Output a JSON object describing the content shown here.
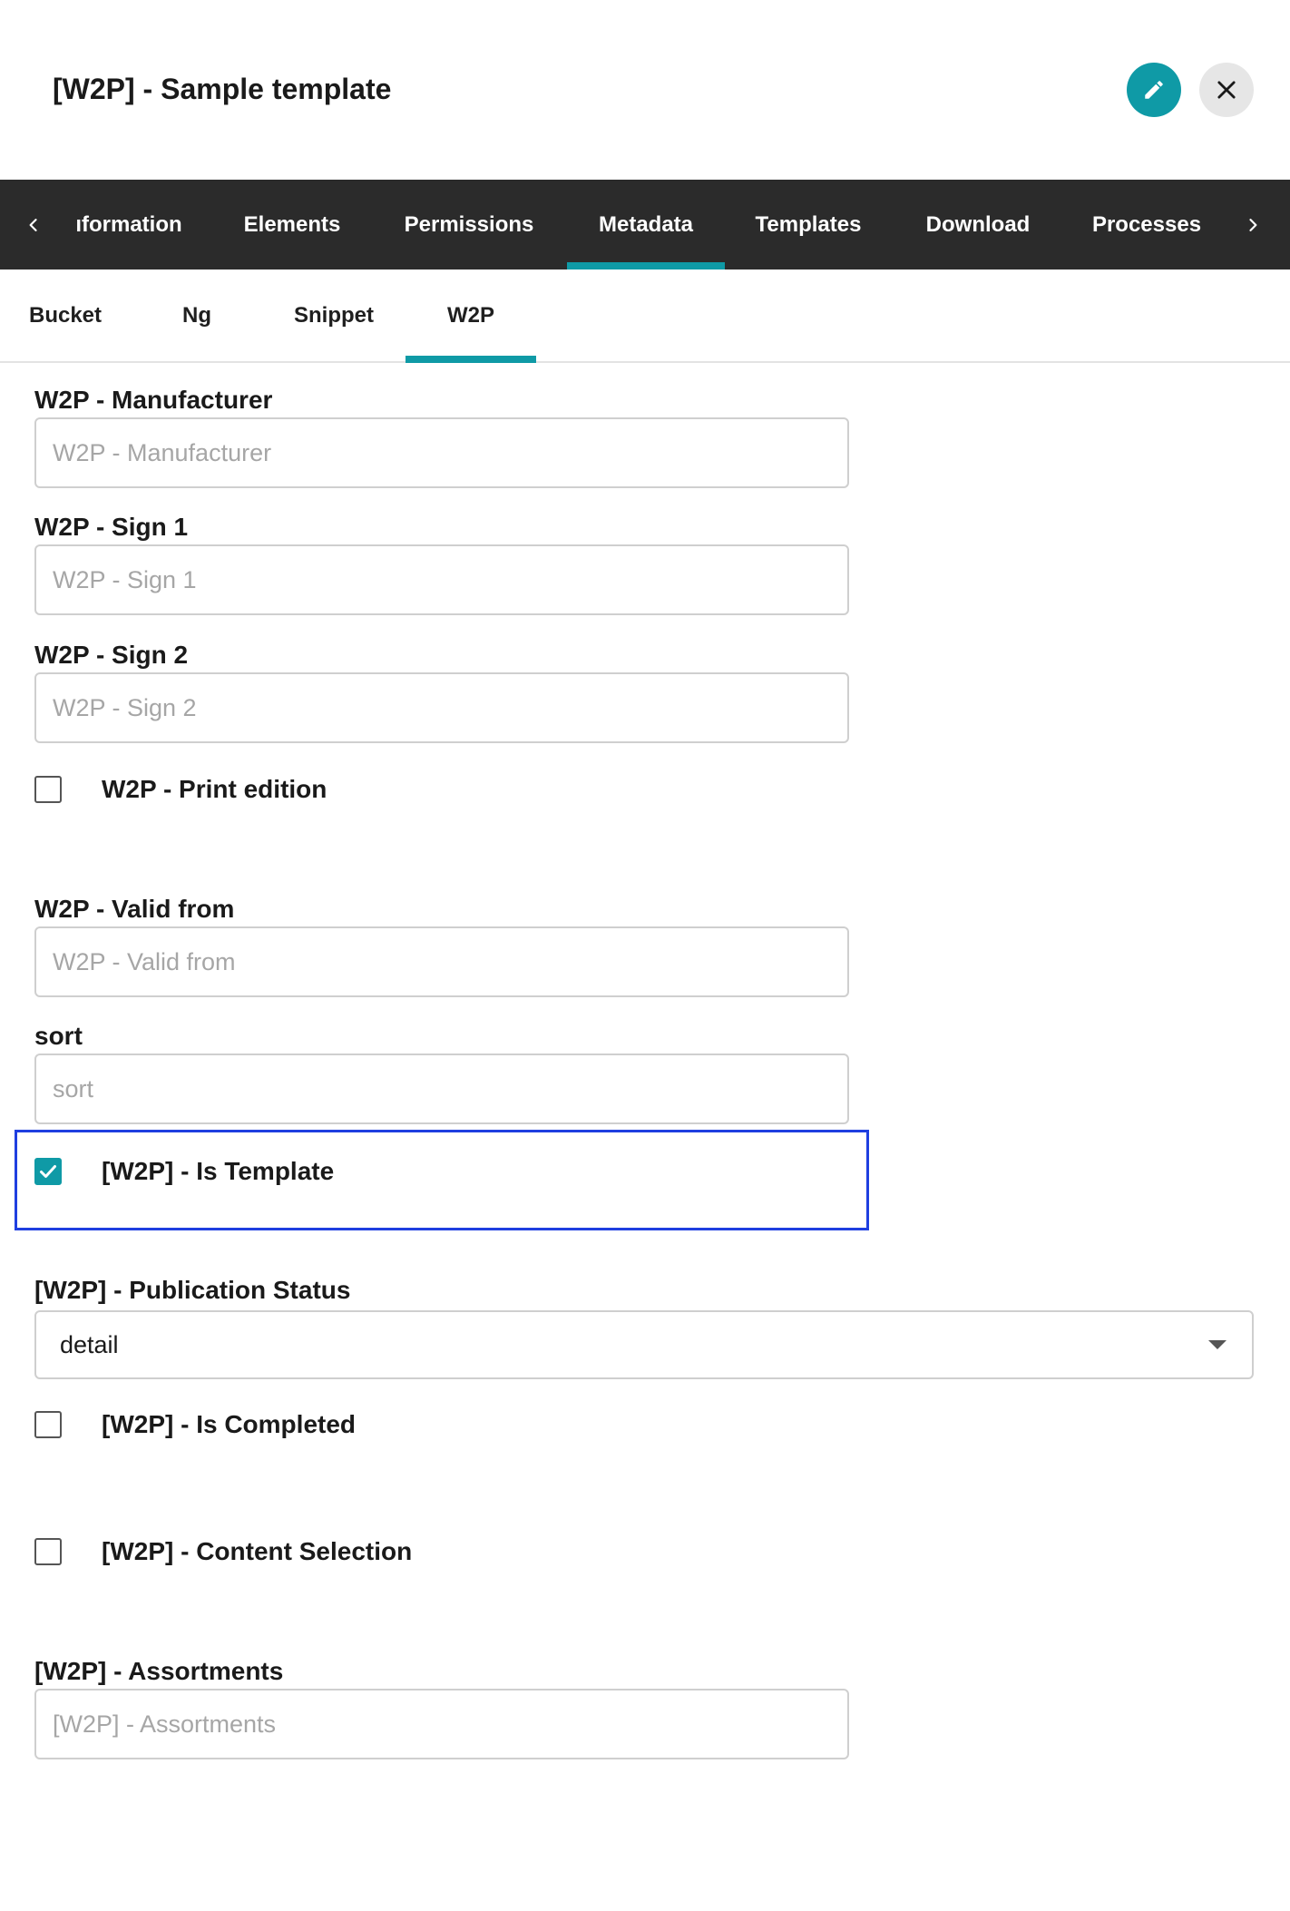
{
  "header": {
    "title": "[W2P] - Sample template"
  },
  "primary_tabs": [
    {
      "label": "ıformation"
    },
    {
      "label": "Elements"
    },
    {
      "label": "Permissions"
    },
    {
      "label": "Metadata",
      "active": true
    },
    {
      "label": "Templates"
    },
    {
      "label": "Download"
    },
    {
      "label": "Processes"
    }
  ],
  "secondary_tabs": [
    {
      "label": "Bucket"
    },
    {
      "label": "Ng"
    },
    {
      "label": "Snippet"
    },
    {
      "label": "W2P",
      "active": true
    }
  ],
  "form": {
    "manufacturer": {
      "label": "W2P - Manufacturer",
      "placeholder": "W2P - Manufacturer",
      "value": ""
    },
    "sign1": {
      "label": "W2P - Sign 1",
      "placeholder": "W2P - Sign 1",
      "value": ""
    },
    "sign2": {
      "label": "W2P - Sign 2",
      "placeholder": "W2P - Sign 2",
      "value": ""
    },
    "print_edition": {
      "label": "W2P - Print edition",
      "checked": false
    },
    "valid_from": {
      "label": "W2P - Valid from",
      "placeholder": "W2P - Valid from",
      "value": ""
    },
    "sort": {
      "label": "sort",
      "placeholder": "sort",
      "value": ""
    },
    "is_template": {
      "label": "[W2P] - Is Template",
      "checked": true
    },
    "publication_status": {
      "label": "[W2P] - Publication Status",
      "value": "detail"
    },
    "is_completed": {
      "label": "[W2P] - Is Completed",
      "checked": false
    },
    "content_selection": {
      "label": "[W2P] - Content Selection",
      "checked": false
    },
    "assortments": {
      "label": "[W2P] - Assortments",
      "placeholder": "[W2P] - Assortments",
      "value": ""
    }
  },
  "colors": {
    "accent": "#0f9aa6",
    "tab_bar": "#2b2b2b",
    "highlight": "#1f3fe0"
  },
  "icons": {
    "edit": "pencil-icon",
    "close": "close-icon",
    "scroll_left": "chevron-left-icon",
    "scroll_right": "chevron-right-icon",
    "select_caret": "caret-down-icon",
    "checkbox_checked": "checkmark-icon"
  }
}
